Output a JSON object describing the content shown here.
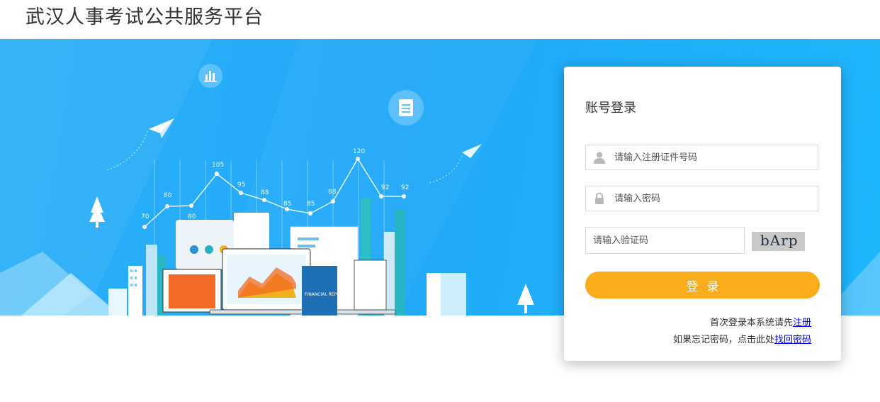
{
  "header": {
    "title": "武汉人事考试公共服务平台"
  },
  "banner": {
    "chart_values": [
      "70",
      "80",
      "80",
      "105",
      "95",
      "88",
      "85",
      "85",
      "88",
      "120",
      "92",
      "92"
    ],
    "report_label": "FINANCIAL REPORT"
  },
  "login": {
    "title": "账号登录",
    "id_placeholder": "请输入注册证件号码",
    "password_placeholder": "请输入密码",
    "captcha_placeholder": "请输入验证码",
    "captcha_text": "bArp",
    "submit_label": "登录",
    "register_prompt": "首次登录本系统请先",
    "register_link": "注册",
    "forgot_prompt": "如果忘记密码，点击此处",
    "forgot_link": "找回密码"
  },
  "colors": {
    "banner_blue": "#21a8f8",
    "button_orange": "#f9ad1a",
    "link_blue": "#0000ee"
  }
}
